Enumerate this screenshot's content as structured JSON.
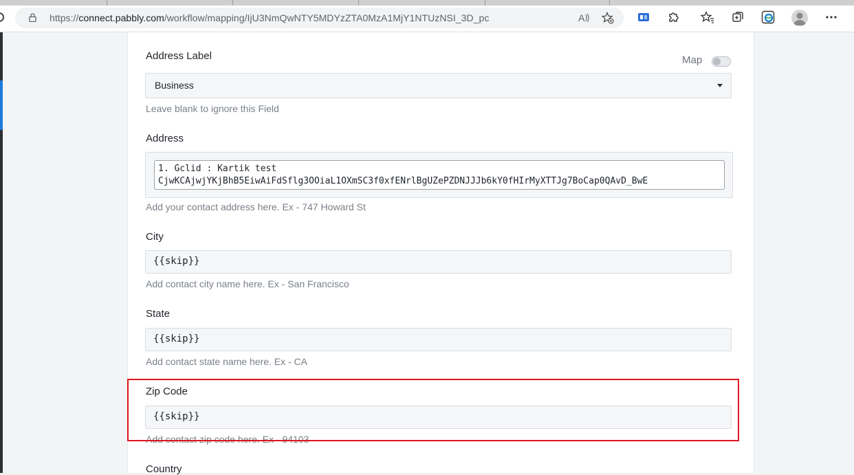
{
  "browser": {
    "url_prefix": "https://",
    "url_domain": "connect.pabbly.com",
    "url_path": "/workflow/mapping/IjU3NmQwNTY5MDYzZTA0MzA1MjY1NTUzNSI_3D_pc",
    "read_aloud_glyph": "A̅"
  },
  "form": {
    "address_label": {
      "label": "Address Label",
      "map_label": "Map",
      "map_enabled": false,
      "selected": "Business",
      "hint": "Leave blank to ignore this Field"
    },
    "address": {
      "label": "Address",
      "value_line1": "1. Gclid : Kartik test",
      "value_line2": "CjwKCAjwjYKjBhB5EiwAiFdSflg3OOiaL1OXmSC3f0xfENrlBgUZePZDNJJJb6kY0fHIrMyXTTJg7BoCap0QAvD_BwE",
      "hint": "Add your contact address here. Ex - 747 Howard St"
    },
    "city": {
      "label": "City",
      "value": "{{skip}}",
      "hint": "Add contact city name here. Ex - San Francisco"
    },
    "state": {
      "label": "State",
      "value": "{{skip}}",
      "hint": "Add contact state name here. Ex - CA"
    },
    "zip": {
      "label": "Zip Code",
      "value": "{{skip}}",
      "hint": "Add contact zip code here. Ex - 94103"
    },
    "country": {
      "label": "Country"
    }
  },
  "colors": {
    "highlight": "#e0141e",
    "accent": "#1f7bdb"
  }
}
